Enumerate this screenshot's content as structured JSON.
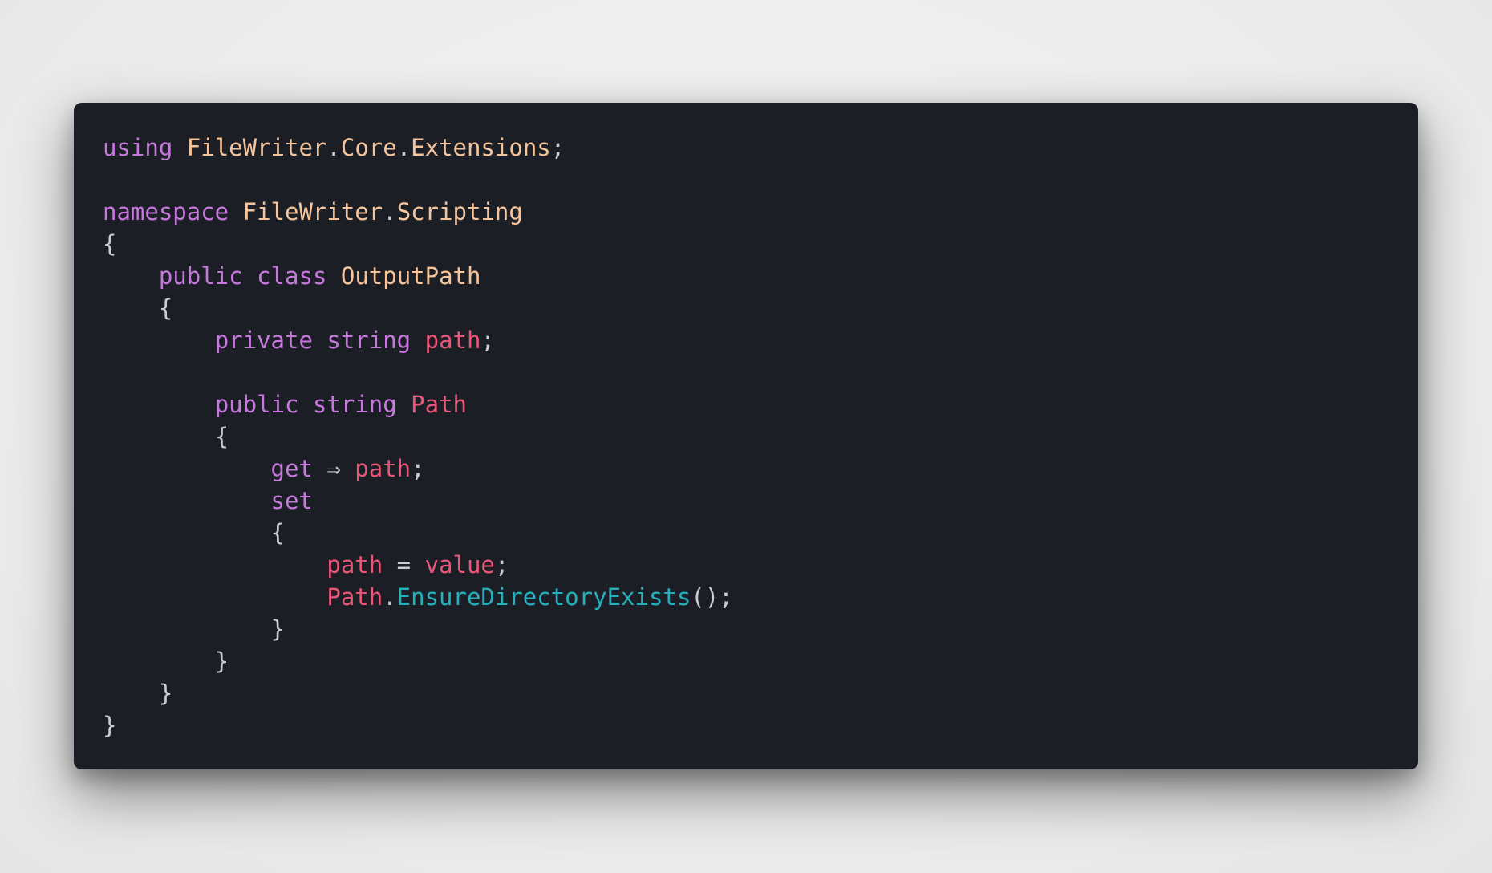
{
  "colors": {
    "background": "#ececec",
    "panel": "#1c1e26",
    "keyword": "#c678dd",
    "type_namespace": "#f5c49a",
    "variable": "#e95678",
    "function": "#25b0bc",
    "punctuation": "#c8ccd4"
  },
  "code": {
    "language": "C#",
    "lines": [
      [
        {
          "t": "using",
          "c": "kw"
        },
        {
          "t": " ",
          "c": "pn"
        },
        {
          "t": "FileWriter",
          "c": "ns"
        },
        {
          "t": ".",
          "c": "pn"
        },
        {
          "t": "Core",
          "c": "ns"
        },
        {
          "t": ".",
          "c": "pn"
        },
        {
          "t": "Extensions",
          "c": "ns"
        },
        {
          "t": ";",
          "c": "pn"
        }
      ],
      [],
      [
        {
          "t": "namespace",
          "c": "kw"
        },
        {
          "t": " ",
          "c": "pn"
        },
        {
          "t": "FileWriter",
          "c": "ns"
        },
        {
          "t": ".",
          "c": "pn"
        },
        {
          "t": "Scripting",
          "c": "ns"
        }
      ],
      [
        {
          "t": "{",
          "c": "pn"
        }
      ],
      [
        {
          "t": "    ",
          "c": "pn"
        },
        {
          "t": "public",
          "c": "kw"
        },
        {
          "t": " ",
          "c": "pn"
        },
        {
          "t": "class",
          "c": "kw"
        },
        {
          "t": " ",
          "c": "pn"
        },
        {
          "t": "OutputPath",
          "c": "ns"
        }
      ],
      [
        {
          "t": "    {",
          "c": "pn"
        }
      ],
      [
        {
          "t": "        ",
          "c": "pn"
        },
        {
          "t": "private",
          "c": "kw"
        },
        {
          "t": " ",
          "c": "pn"
        },
        {
          "t": "string",
          "c": "kw"
        },
        {
          "t": " ",
          "c": "pn"
        },
        {
          "t": "path",
          "c": "var"
        },
        {
          "t": ";",
          "c": "pn"
        }
      ],
      [],
      [
        {
          "t": "        ",
          "c": "pn"
        },
        {
          "t": "public",
          "c": "kw"
        },
        {
          "t": " ",
          "c": "pn"
        },
        {
          "t": "string",
          "c": "kw"
        },
        {
          "t": " ",
          "c": "pn"
        },
        {
          "t": "Path",
          "c": "var"
        }
      ],
      [
        {
          "t": "        {",
          "c": "pn"
        }
      ],
      [
        {
          "t": "            ",
          "c": "pn"
        },
        {
          "t": "get",
          "c": "kw"
        },
        {
          "t": " ⇒ ",
          "c": "pn"
        },
        {
          "t": "path",
          "c": "var"
        },
        {
          "t": ";",
          "c": "pn"
        }
      ],
      [
        {
          "t": "            ",
          "c": "pn"
        },
        {
          "t": "set",
          "c": "kw"
        }
      ],
      [
        {
          "t": "            {",
          "c": "pn"
        }
      ],
      [
        {
          "t": "                ",
          "c": "pn"
        },
        {
          "t": "path",
          "c": "var"
        },
        {
          "t": " = ",
          "c": "pn"
        },
        {
          "t": "value",
          "c": "var"
        },
        {
          "t": ";",
          "c": "pn"
        }
      ],
      [
        {
          "t": "                ",
          "c": "pn"
        },
        {
          "t": "Path",
          "c": "var"
        },
        {
          "t": ".",
          "c": "pn"
        },
        {
          "t": "EnsureDirectoryExists",
          "c": "fn"
        },
        {
          "t": "();",
          "c": "pn"
        }
      ],
      [
        {
          "t": "            }",
          "c": "pn"
        }
      ],
      [
        {
          "t": "        }",
          "c": "pn"
        }
      ],
      [
        {
          "t": "    }",
          "c": "pn"
        }
      ],
      [
        {
          "t": "}",
          "c": "pn"
        }
      ]
    ]
  }
}
